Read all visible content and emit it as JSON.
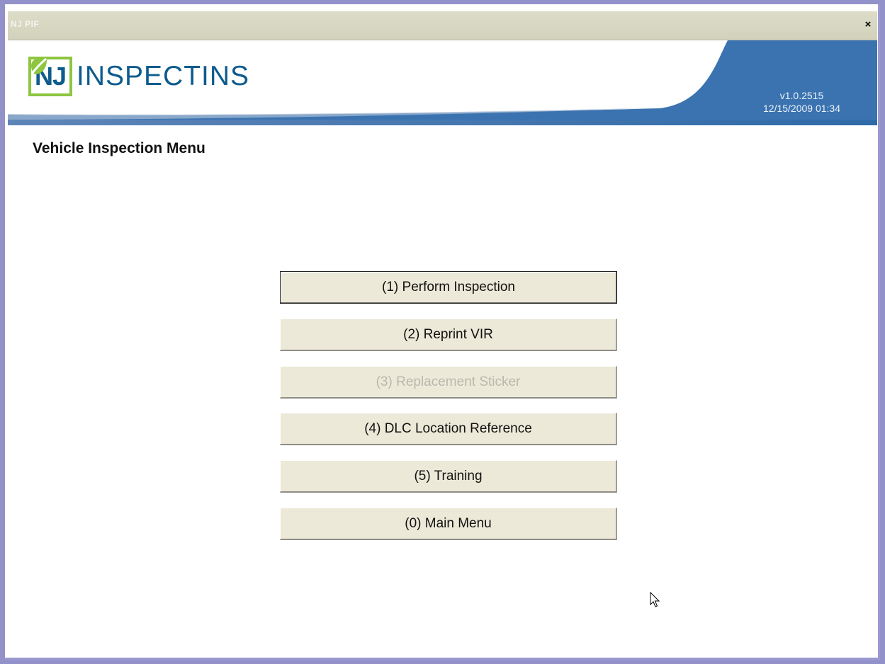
{
  "window": {
    "title": "NJ PIF",
    "close_glyph": "×"
  },
  "header": {
    "logo_prefix": "NJ",
    "logo_word_start": "INSPECTI",
    "logo_word_end": "NS",
    "version": "v1.0.2515",
    "datetime": "12/15/2009 01:34"
  },
  "page": {
    "title": "Vehicle Inspection Menu"
  },
  "menu": [
    {
      "label": "(1) Perform Inspection",
      "enabled": true,
      "focused": true
    },
    {
      "label": "(2) Reprint VIR",
      "enabled": true
    },
    {
      "label": "(3) Replacement Sticker",
      "enabled": false
    },
    {
      "label": "(4) DLC Location Reference",
      "enabled": true
    },
    {
      "label": "(5) Training",
      "enabled": true
    },
    {
      "label": "(0) Main Menu",
      "enabled": true
    }
  ],
  "colors": {
    "brand_blue": "#0e5b8e",
    "brand_green": "#8dc63f",
    "header_band": "#3b73b0"
  }
}
